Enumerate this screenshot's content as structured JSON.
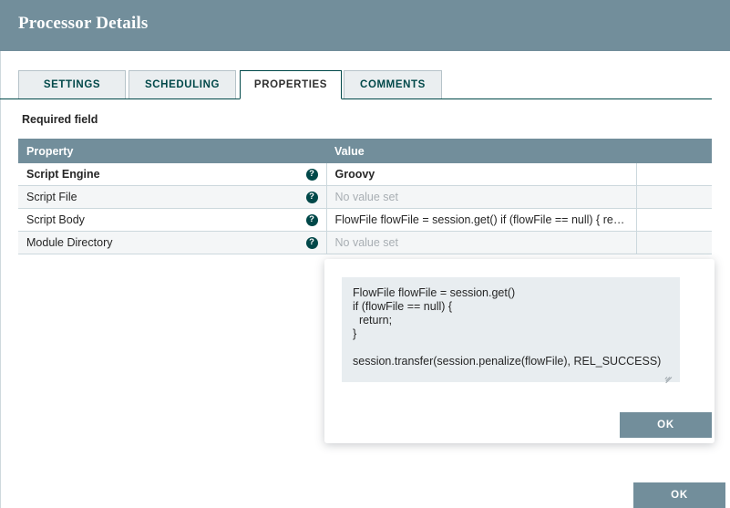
{
  "header": {
    "title": "Processor Details"
  },
  "tabs": [
    {
      "label": "SETTINGS",
      "active": false
    },
    {
      "label": "SCHEDULING",
      "active": false
    },
    {
      "label": "PROPERTIES",
      "active": true
    },
    {
      "label": "COMMENTS",
      "active": false
    }
  ],
  "required_field_note": "Required field",
  "table": {
    "columns": [
      "Property",
      "Value",
      ""
    ],
    "rows": [
      {
        "property": "Script Engine",
        "required": true,
        "help": "?",
        "value": "Groovy",
        "value_empty": false,
        "extra": ""
      },
      {
        "property": "Script File",
        "required": false,
        "help": "?",
        "value": "No value set",
        "value_empty": true,
        "extra": ""
      },
      {
        "property": "Script Body",
        "required": false,
        "help": "?",
        "value": "FlowFile flowFile = session.get() if (flowFile == null) { return; …",
        "value_empty": false,
        "extra": ""
      },
      {
        "property": "Module Directory",
        "required": false,
        "help": "?",
        "value": "No value set",
        "value_empty": true,
        "extra": ""
      }
    ]
  },
  "code_popup": {
    "code": "FlowFile flowFile = session.get()\nif (flowFile == null) {\n  return;\n}\n\nsession.transfer(session.penalize(flowFile), REL_SUCCESS)",
    "ok_label": "OK"
  },
  "footer": {
    "ok_label": "OK"
  },
  "colors": {
    "header_bar": "#728e9b",
    "table_header": "#728e9b",
    "accent_teal": "#004849",
    "button": "#728e9b",
    "row_even": "#f4f6f7",
    "code_bg": "#e8edf0",
    "border": "#ccd8dd"
  }
}
